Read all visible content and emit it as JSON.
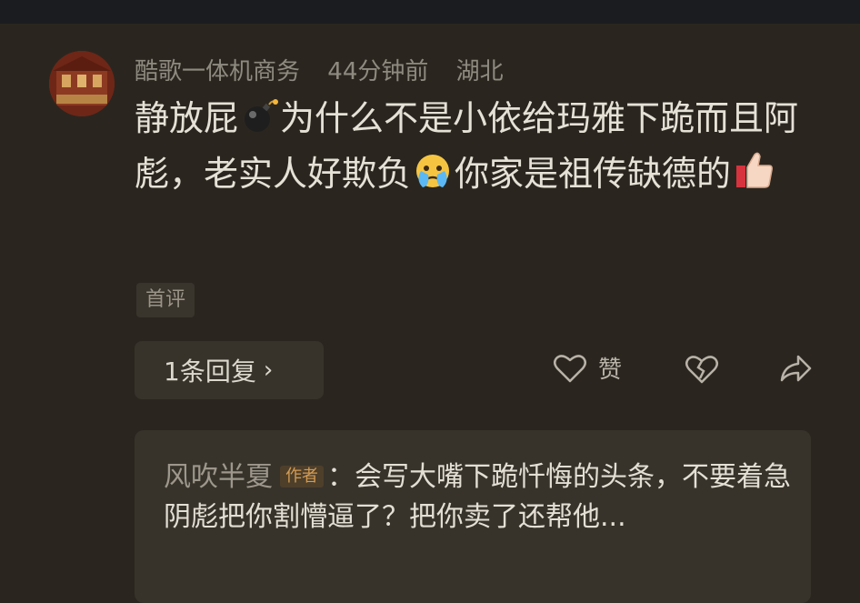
{
  "comment": {
    "username": "酷歌一体机商务",
    "time": "44分钟前",
    "location": "湖北",
    "text_part1": "静放屁",
    "text_part2": "为什么不是小依给玛雅下跪而且阿彪，老实人好欺负",
    "text_part3": "你家是祖传缺德的",
    "emoji_icons": [
      "bomb-icon",
      "crying-face-icon",
      "thumbs-up-icon"
    ],
    "tag": "首评",
    "reply_button": "1条回复",
    "like_label": "赞"
  },
  "reply": {
    "name": "风吹半夏",
    "author_badge": "作者",
    "separator": "：",
    "text": "会写大嘴下跪忏悔的头条，不要着急",
    "text_line2": "阴彪把你割懵逼了？把你卖了还帮他..."
  },
  "colors": {
    "background": "#2a261f",
    "card": "#37332b",
    "author_badge": "#d39b53"
  }
}
